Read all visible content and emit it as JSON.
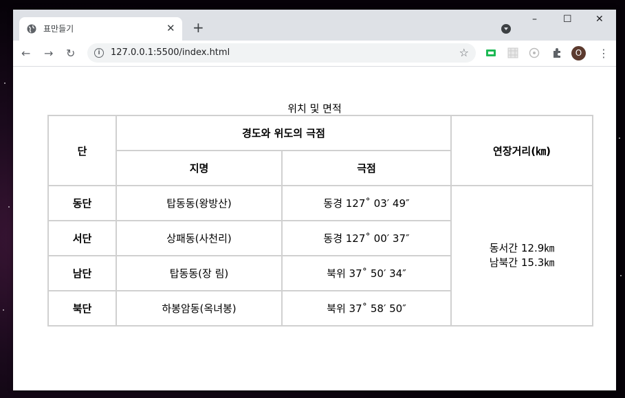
{
  "browser": {
    "tab_title": "표만들기",
    "url": "127.0.0.1:5500/index.html",
    "avatar_letter": "O",
    "icons": {
      "tab": "globe-icon",
      "back": "back-arrow-icon",
      "forward": "forward-arrow-icon",
      "reload": "reload-icon",
      "info": "info-icon",
      "bookmark": "star-icon",
      "extensions": "puzzle-icon",
      "menu": "kebab-menu-icon"
    }
  },
  "table": {
    "caption": "위치 및 면적",
    "headers": {
      "col1": "단",
      "group": "경도와 위도의 극점",
      "sub1": "지명",
      "sub2": "극점",
      "col4": "연장거리(㎞)"
    },
    "rows": [
      {
        "dan": "동단",
        "place": "탑동동(왕방산)",
        "point": "동경 127˚ 03′ 49″"
      },
      {
        "dan": "서단",
        "place": "상패동(사천리)",
        "point": "동경 127˚ 00′ 37″"
      },
      {
        "dan": "남단",
        "place": "탑동동(장 림)",
        "point": "북위 37˚ 50′ 34″"
      },
      {
        "dan": "북단",
        "place": "하봉암동(옥녀봉)",
        "point": "북위 37˚ 58′ 50″"
      }
    ],
    "extent": {
      "line1": "동서간 12.9㎞",
      "line2": "남북간 15.3㎞"
    }
  }
}
